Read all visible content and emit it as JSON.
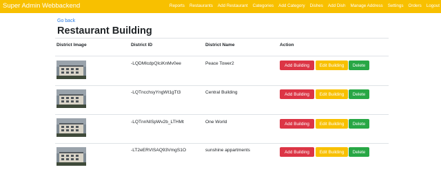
{
  "navbar": {
    "brand": "Super Admin Webbackend",
    "links": [
      "Reports",
      "Restaurants",
      "Add Restaurant",
      "Categories",
      "Add Category",
      "Dishes",
      "Add Dish",
      "Manage Address",
      "Settings",
      "Orders",
      "Logout"
    ]
  },
  "page": {
    "back_link": "Go back",
    "title": "Restaurant Building"
  },
  "table": {
    "headers": [
      "District Image",
      "District ID",
      "District Name",
      "Action"
    ],
    "rows": [
      {
        "id": "-LQDMlcdpQIciKnMv0ee",
        "name": "Peace Tower2"
      },
      {
        "id": "-LQTncchsyYngWt1gTt3",
        "name": "Central Building"
      },
      {
        "id": "-LQTnnNISpWv2b_LTHMt",
        "name": "One World"
      },
      {
        "id": "-LT2eERVISAQ93VmgS1O",
        "name": "sunshine appartments"
      }
    ],
    "actions": {
      "add": "Add Building",
      "edit": "Edit Building",
      "delete": "Delete"
    }
  },
  "colors": {
    "navbar": "#f8c000",
    "add": "#dc3545",
    "edit": "#f8c000",
    "delete": "#28a745",
    "link": "#2a7ae2"
  }
}
